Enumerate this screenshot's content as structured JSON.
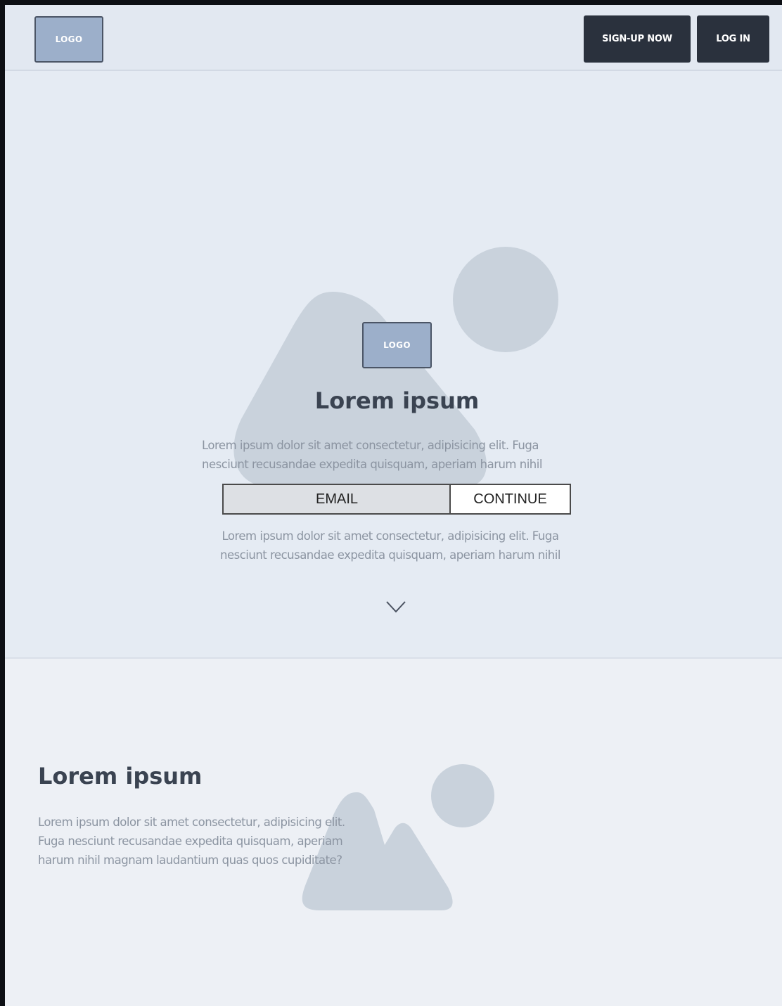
{
  "header": {
    "logo_label": "LOGO",
    "signup_label": "SIGN-UP NOW",
    "login_label": "LOG IN"
  },
  "hero": {
    "logo_label": "LOGO",
    "title": "Lorem ipsum",
    "text_top_line1": "Lorem ipsum dolor sit amet consectetur, adipisicing elit. Fuga",
    "text_top_line2": "nesciunt recusandae expedita quisquam, aperiam harum nihil",
    "email_label": "EMAIL",
    "continue_label": "CONTINUE",
    "text_bottom_line1": "Lorem ipsum dolor sit amet consectetur, adipisicing elit. Fuga",
    "text_bottom_line2": "nesciunt recusandae expedita quisquam, aperiam harum nihil",
    "scroll_icon": "chevron-down-icon"
  },
  "section2": {
    "title": "Lorem ipsum",
    "text_line1": "Lorem ipsum dolor sit amet consectetur, adipisicing elit.",
    "text_line2": "Fuga nesciunt recusandae expedita quisquam, aperiam",
    "text_line3": "harum nihil magnam laudantium quas quos cupiditate?"
  },
  "colors": {
    "dark_button": "#2a313d",
    "logo_fill": "#9cafca",
    "placeholder_shape": "#c9d2dc",
    "hero_bg": "#e5ebf3",
    "section2_bg": "#edf0f5"
  }
}
